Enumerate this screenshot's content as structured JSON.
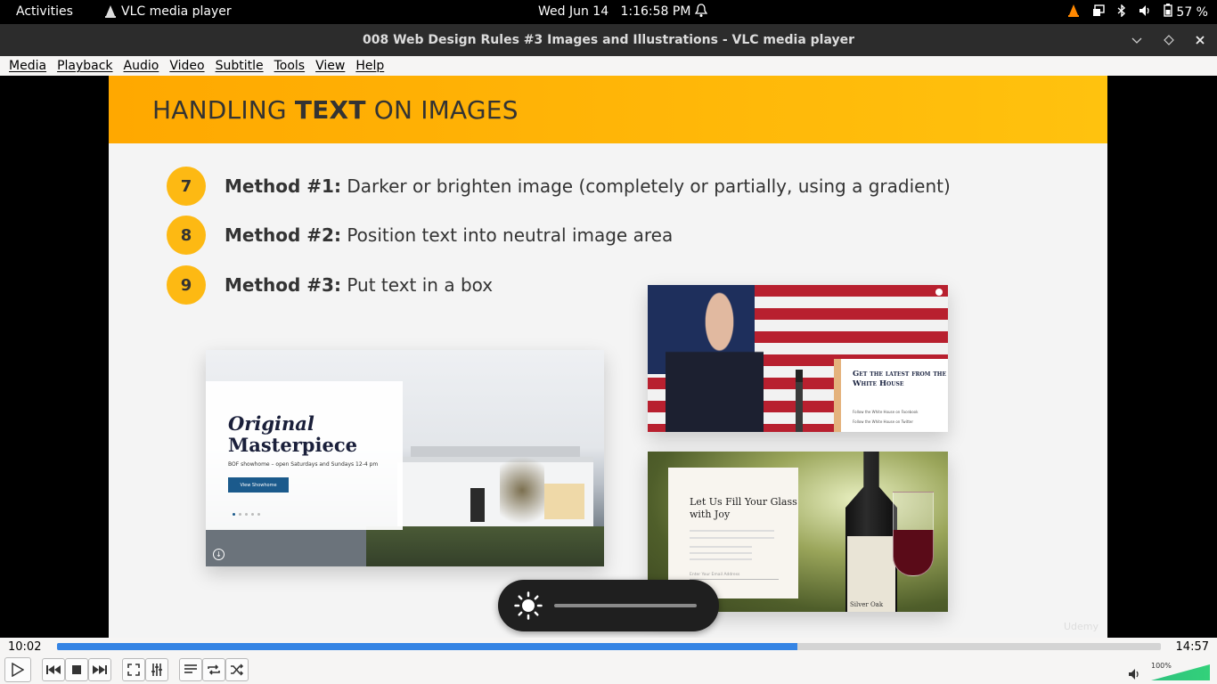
{
  "topbar": {
    "activities": "Activities",
    "app_name": "VLC media player",
    "date": "Wed Jun 14",
    "time": "1:16:58 PM",
    "battery": "57 %"
  },
  "window": {
    "title": "008 Web Design Rules #3 Images and Illustrations - VLC media player"
  },
  "menu": [
    "Media",
    "Playback",
    "Audio",
    "Video",
    "Subtitle",
    "Tools",
    "View",
    "Help"
  ],
  "slide": {
    "title_pre": "HANDLING ",
    "title_bold": "TEXT",
    "title_post": " ON IMAGES",
    "methods": [
      {
        "num": "7",
        "label": "Method #1:",
        "text": " Darker or brighten image (completely or partially, using a gradient)"
      },
      {
        "num": "8",
        "label": "Method #2:",
        "text": " Position text into neutral image area"
      },
      {
        "num": "9",
        "label": "Method #3:",
        "text": " Put text in a box"
      }
    ],
    "house": {
      "title_line1": "Original",
      "title_line2": "Masterpiece",
      "sub": "BOF showhome – open Saturdays and Sundays 12-4 pm",
      "button": "View Showhome"
    },
    "whitehouse": {
      "title": "Get the latest from the White House",
      "link1": "Follow the White House on Facebook",
      "link2": "Follow the White House on Twitter"
    },
    "wine": {
      "title": "Let Us Fill Your Glass with Joy",
      "email_placeholder": "Enter Your Email Address",
      "label": "Silver Oak"
    },
    "watermark": "Udemy"
  },
  "player": {
    "current_time": "10:02",
    "total_time": "14:57",
    "progress": 0.6711,
    "volume_label": "100%",
    "volume": 1.0
  },
  "osd": {
    "brightness": 1.0
  }
}
